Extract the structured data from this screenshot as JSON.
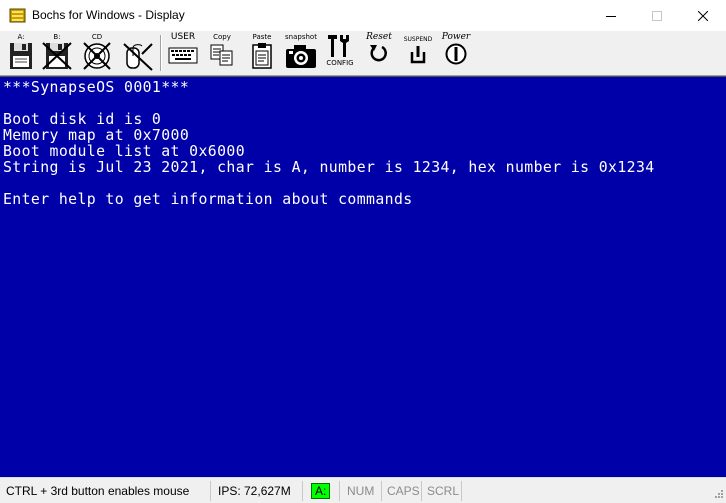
{
  "window": {
    "title": "Bochs for Windows - Display"
  },
  "toolbar": {
    "buttons": [
      {
        "id": "floppy-a",
        "label": "A:",
        "icon": "floppy-disk-icon"
      },
      {
        "id": "floppy-b",
        "label": "B:",
        "icon": "floppy-disk-disabled-icon"
      },
      {
        "id": "cdrom",
        "label": "CD",
        "icon": "cdrom-disabled-icon"
      },
      {
        "id": "mouse",
        "label": "",
        "icon": "mouse-disabled-icon"
      },
      {
        "id": "user",
        "label": "USER",
        "icon": "keyboard-icon"
      },
      {
        "id": "copy",
        "label": "Copy",
        "icon": "copy-icon"
      },
      {
        "id": "paste",
        "label": "Paste",
        "icon": "paste-icon"
      },
      {
        "id": "snapshot",
        "label": "snapshot",
        "icon": "camera-icon"
      },
      {
        "id": "config",
        "label": "CONFIG",
        "icon": "config-tools-icon"
      },
      {
        "id": "reset",
        "label": "Reset",
        "icon": "reset-icon"
      },
      {
        "id": "suspend",
        "label": "SUSPEND",
        "icon": "suspend-icon"
      },
      {
        "id": "power",
        "label": "Power",
        "icon": "power-icon"
      }
    ]
  },
  "screen": {
    "background": "#0000a8",
    "foreground": "#ffffff",
    "lines": [
      "***SynapseOS 0001***",
      "",
      "Boot disk id is 0",
      "Memory map at 0x7000",
      "Boot module list at 0x6000",
      "String is Jul 23 2021, char is A, number is 1234, hex number is 0x1234",
      "",
      "Enter help to get information about commands"
    ]
  },
  "statusbar": {
    "hint": "CTRL + 3rd button enables mouse",
    "ips": "IPS: 72,627M",
    "floppy": "A:",
    "num": "NUM",
    "caps": "CAPS",
    "scrl": "SCRL",
    "led_color": "#00ff00"
  }
}
